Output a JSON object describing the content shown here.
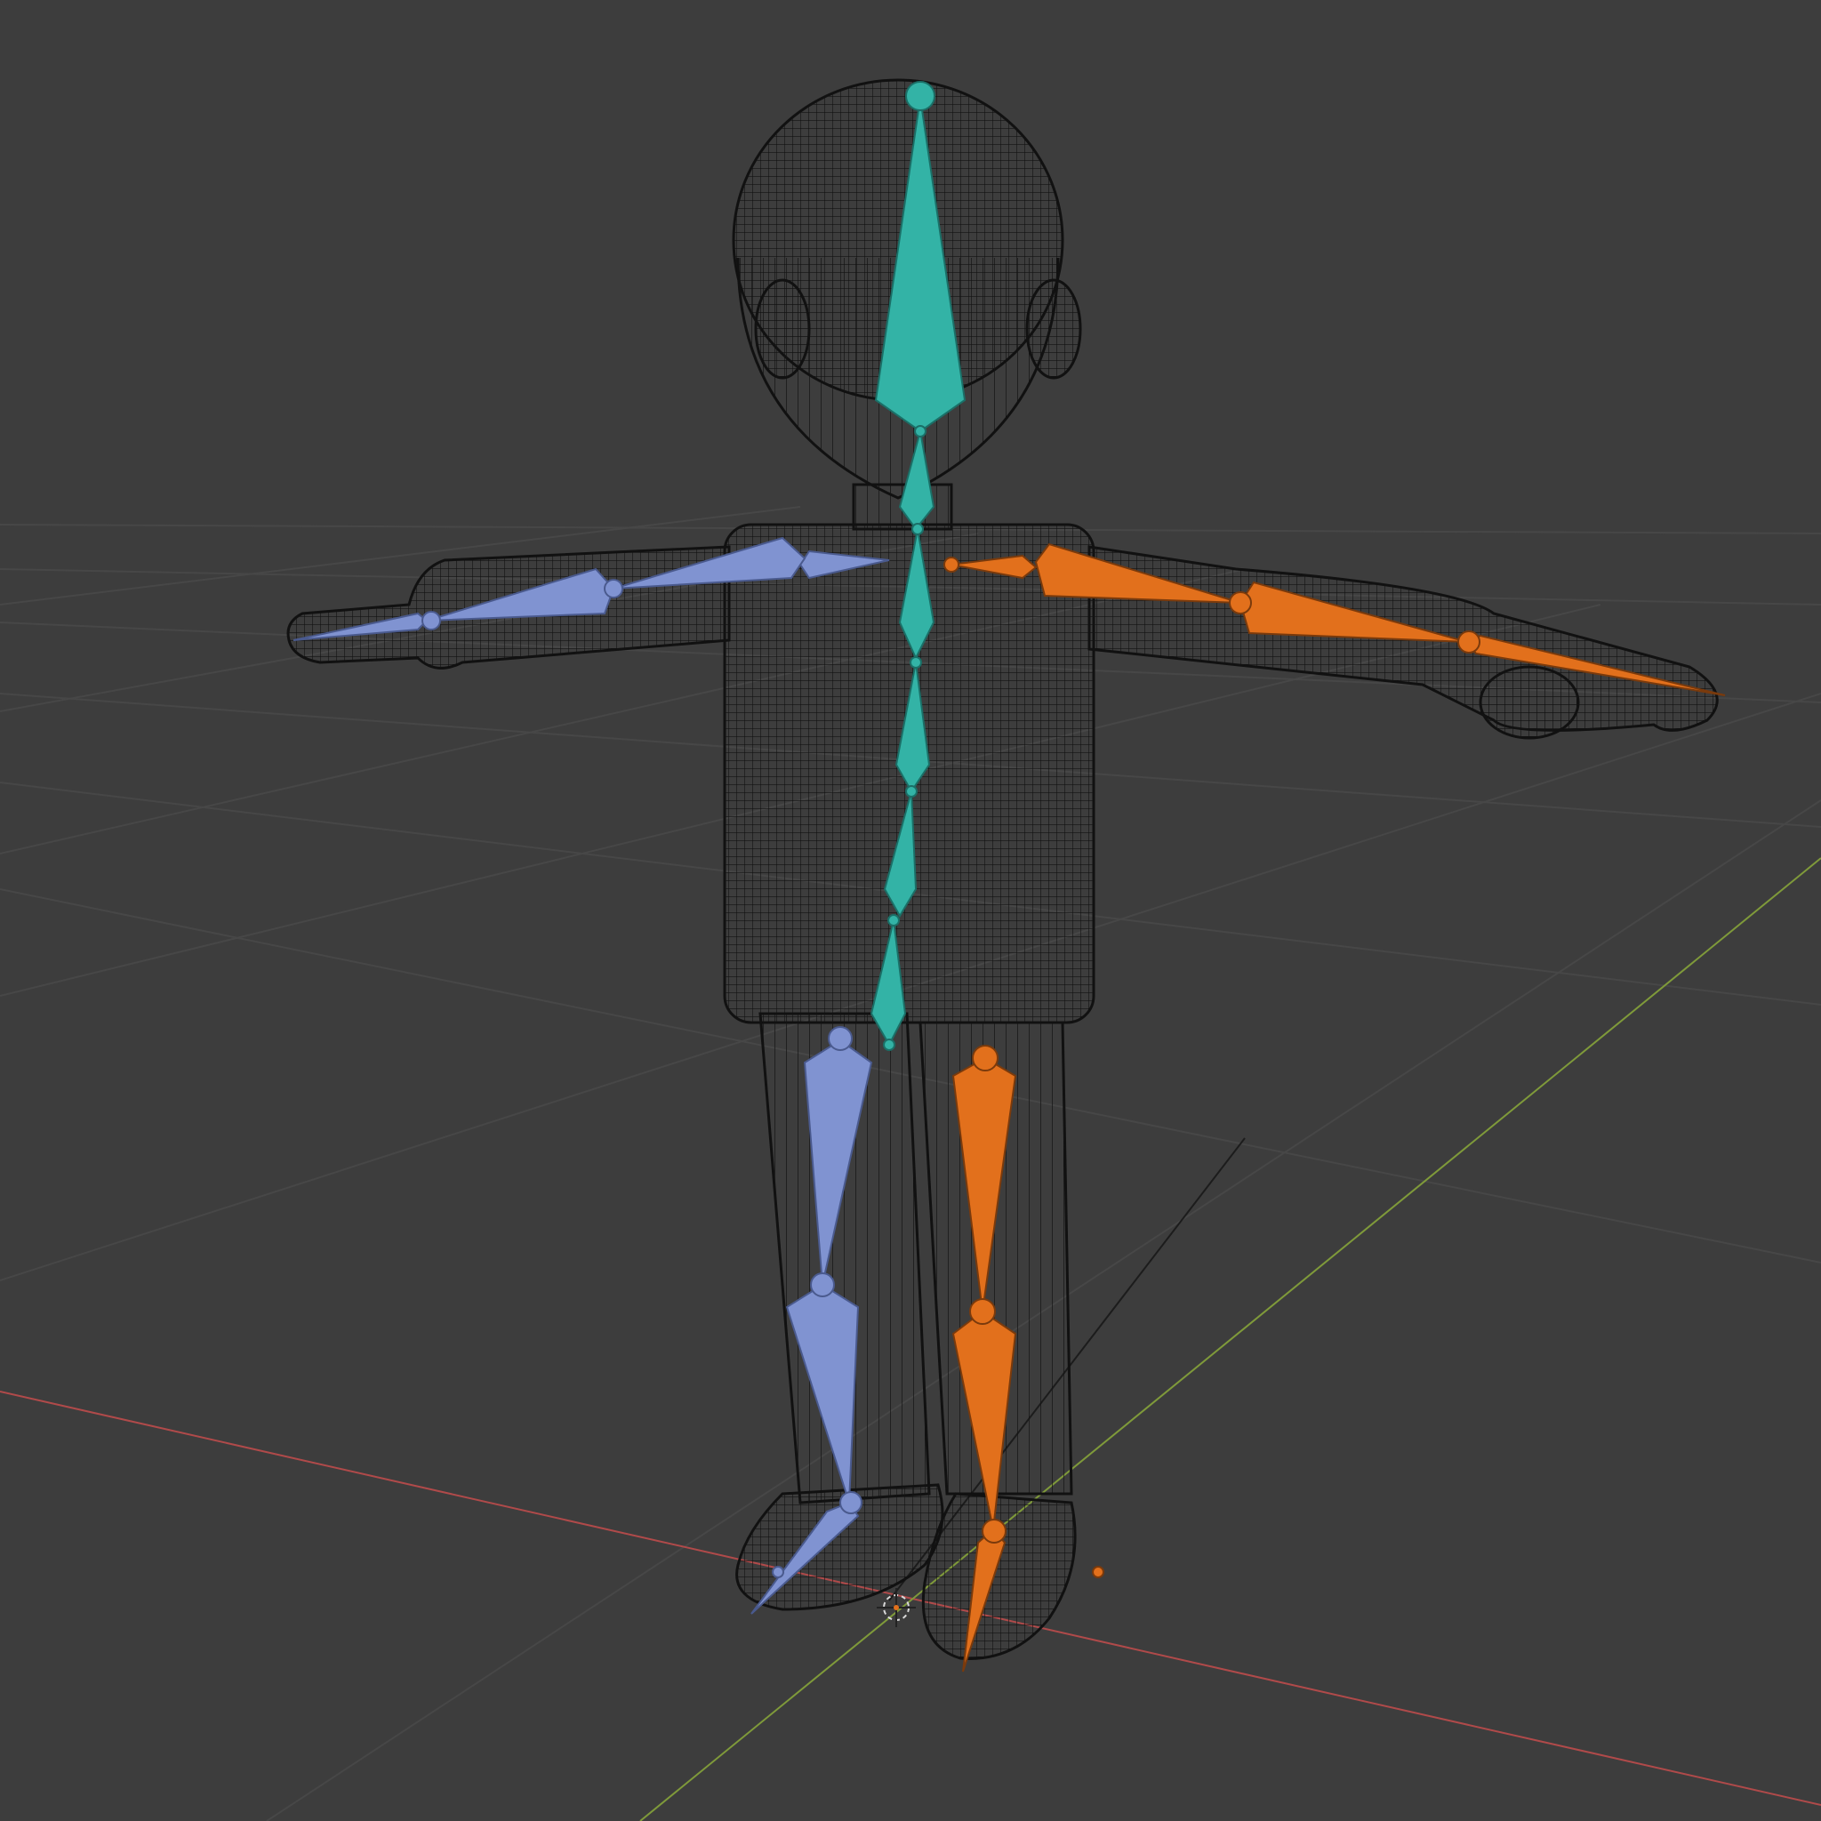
{
  "viewport": {
    "background": "#3d3d3d",
    "grid_color": "#4a4a4a",
    "x_axis_color": "#b04a4a",
    "y_axis_color": "#7f9a3a",
    "wireframe_color": "#111111",
    "bone_colors": {
      "center": "#33b3a6",
      "left": "#8093d1",
      "right": "#e2701c"
    },
    "icons": [
      "3d-cursor-icon"
    ]
  }
}
